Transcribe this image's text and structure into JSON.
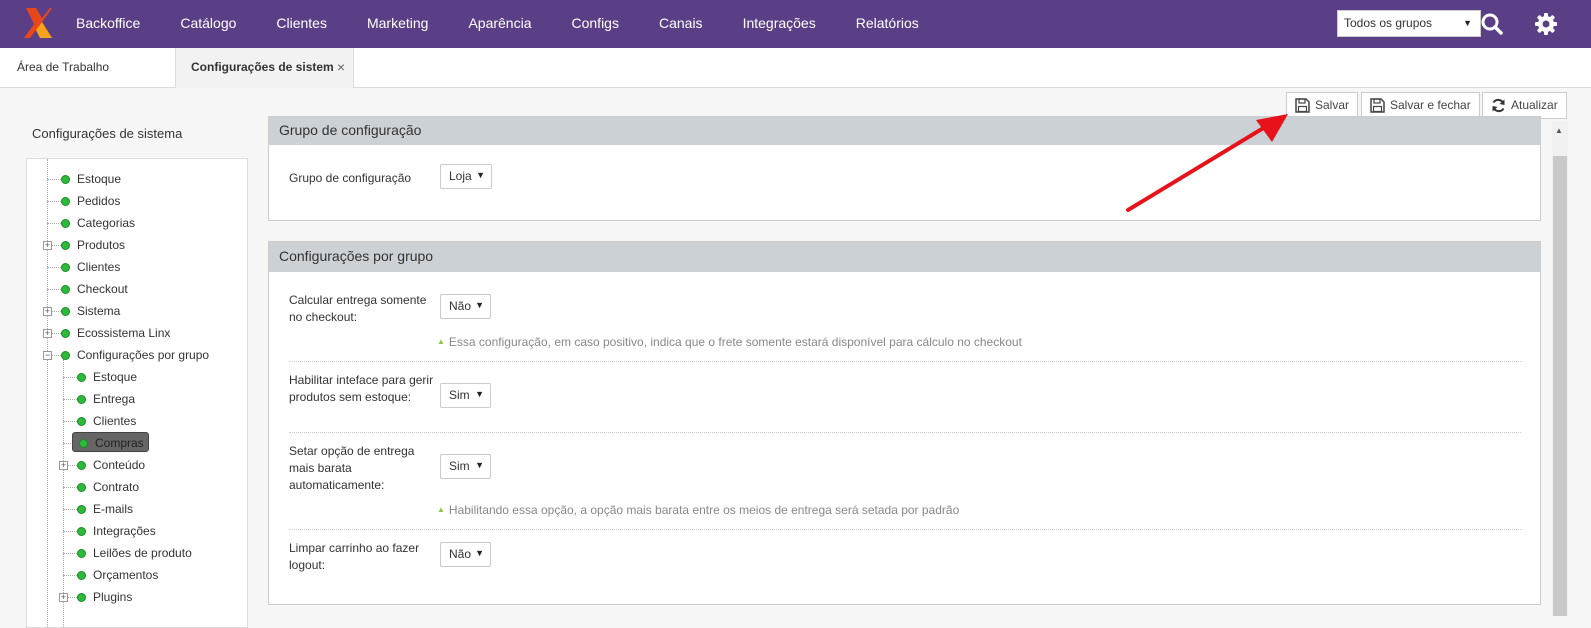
{
  "nav": {
    "items": [
      "Backoffice",
      "Catálogo",
      "Clientes",
      "Marketing",
      "Aparência",
      "Configs",
      "Canais",
      "Integrações",
      "Relatórios"
    ],
    "group_select": "Todos os grupos"
  },
  "tabs": {
    "home": "Área de Trabalho",
    "active": "Configurações de sistem",
    "close": "×"
  },
  "toolbar": {
    "save": "Salvar",
    "save_close": "Salvar e fechar",
    "refresh": "Atualizar"
  },
  "sidebar": {
    "title": "Configurações de sistema",
    "items": [
      {
        "label": "Estoque"
      },
      {
        "label": "Pedidos"
      },
      {
        "label": "Categorias"
      },
      {
        "label": "Produtos"
      },
      {
        "label": "Clientes"
      },
      {
        "label": "Checkout"
      },
      {
        "label": "Sistema"
      },
      {
        "label": "Ecossistema Linx"
      },
      {
        "label": "Configurações por grupo"
      },
      {
        "label": "Estoque"
      },
      {
        "label": "Entrega"
      },
      {
        "label": "Clientes"
      },
      {
        "label": "Compras"
      },
      {
        "label": "Conteúdo"
      },
      {
        "label": "Contrato"
      },
      {
        "label": "E-mails"
      },
      {
        "label": "Integrações"
      },
      {
        "label": "Leilões de produto"
      },
      {
        "label": "Orçamentos"
      },
      {
        "label": "Plugins"
      }
    ]
  },
  "config_group": {
    "title": "Grupo de configuração",
    "label": "Grupo de configuração",
    "value": "Loja"
  },
  "group_settings": {
    "title": "Configurações por grupo",
    "rows": [
      {
        "label": "Calcular entrega somente no checkout:",
        "value": "Não",
        "hint": "Essa configuração, em caso positivo, indica que o frete somente estará disponível para cálculo no checkout"
      },
      {
        "label": "Habilitar inteface para gerir produtos sem estoque:",
        "value": "Sim",
        "hint": ""
      },
      {
        "label": "Setar opção de entrega mais barata automaticamente:",
        "value": "Sim",
        "hint": "Habilitando essa opção, a opção mais barata entre os meios de entrega será setada por padrão"
      },
      {
        "label": "Limpar carrinho ao fazer logout:",
        "value": "Não",
        "hint": ""
      }
    ]
  },
  "colors": {
    "topbar": "#5b3f86",
    "panel_header": "#ccd1d6",
    "node_dot": "#2dba3a",
    "hint_arrow": "#8cc63f",
    "annotation_arrow": "#e8121b"
  },
  "icons": {
    "logo": "brand-logo-icon",
    "search": "search-icon",
    "settings": "gear-icon",
    "save": "floppy-disk-icon",
    "refresh": "refresh-icon"
  }
}
